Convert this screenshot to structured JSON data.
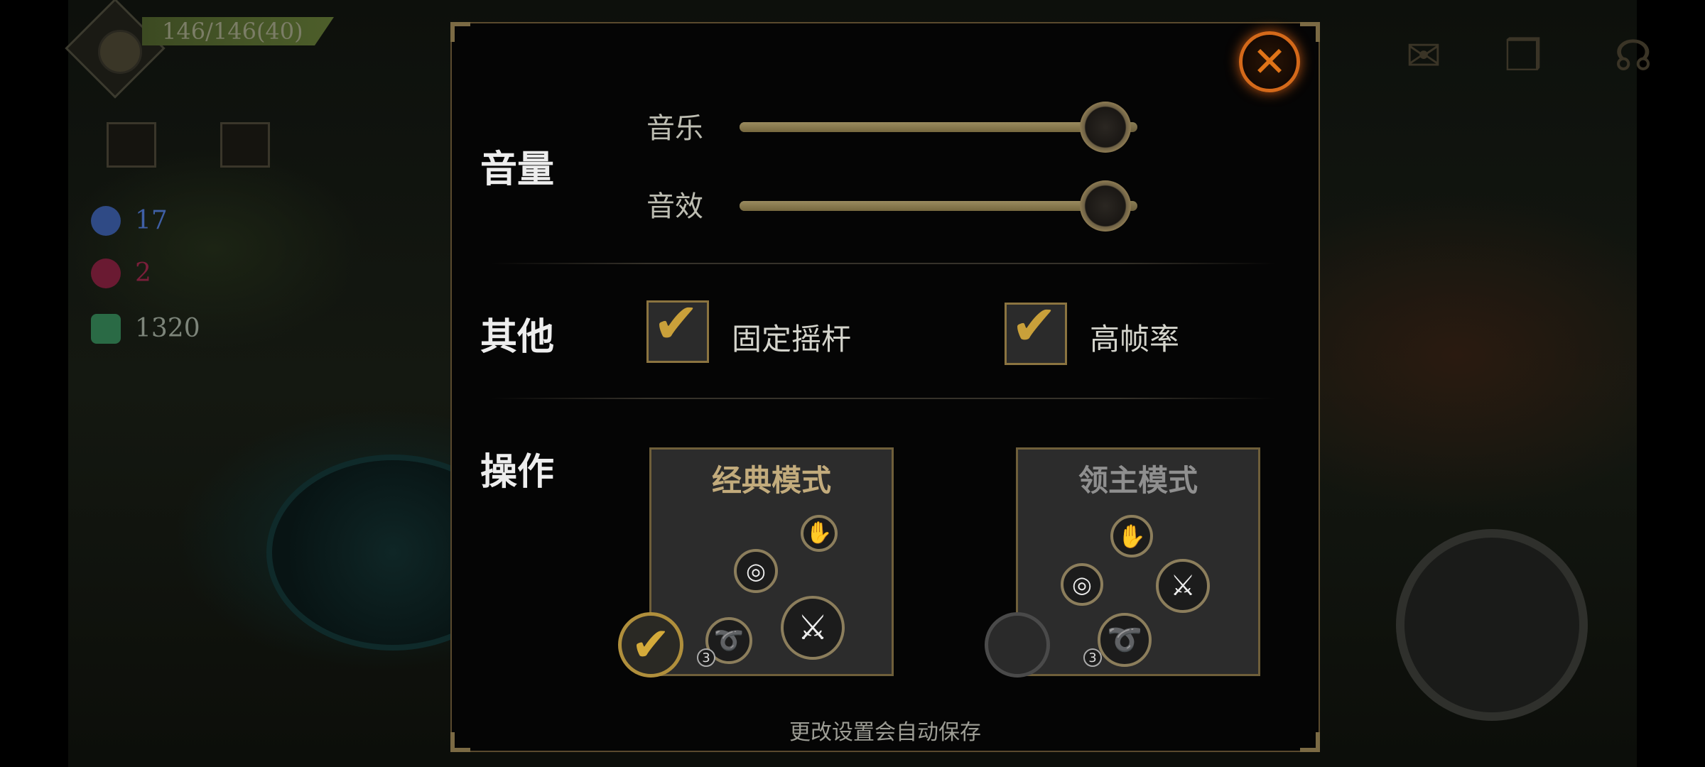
{
  "hud": {
    "hp_text": "146/146(40)",
    "resources": [
      {
        "name": "blue-orb",
        "value": "17",
        "color": "#3f5fa5"
      },
      {
        "name": "red-orb",
        "value": "2",
        "color": "#7a1e3a"
      },
      {
        "name": "green-gem",
        "value": "1320",
        "color": "#3a7a55"
      }
    ]
  },
  "settings": {
    "volume_label": "音量",
    "music_label": "音乐",
    "music_level": 0.92,
    "sfx_label": "音效",
    "sfx_level": 0.92,
    "other_label": "其他",
    "fixed_joystick_label": "固定摇杆",
    "fixed_joystick_checked": true,
    "high_framerate_label": "高帧率",
    "high_framerate_checked": true,
    "controls_label": "操作",
    "classic_mode_label": "经典模式",
    "classic_mode_selected": true,
    "lord_mode_label": "领主模式",
    "lord_mode_selected": false,
    "skill_charge_count": "3",
    "footer_note": "更改设置会自动保存"
  },
  "colors": {
    "accent_gold": "#c9a03a",
    "close_orange": "#d4691a",
    "classic_title": "#c2ab7c",
    "lord_title": "#8f8f8f"
  }
}
